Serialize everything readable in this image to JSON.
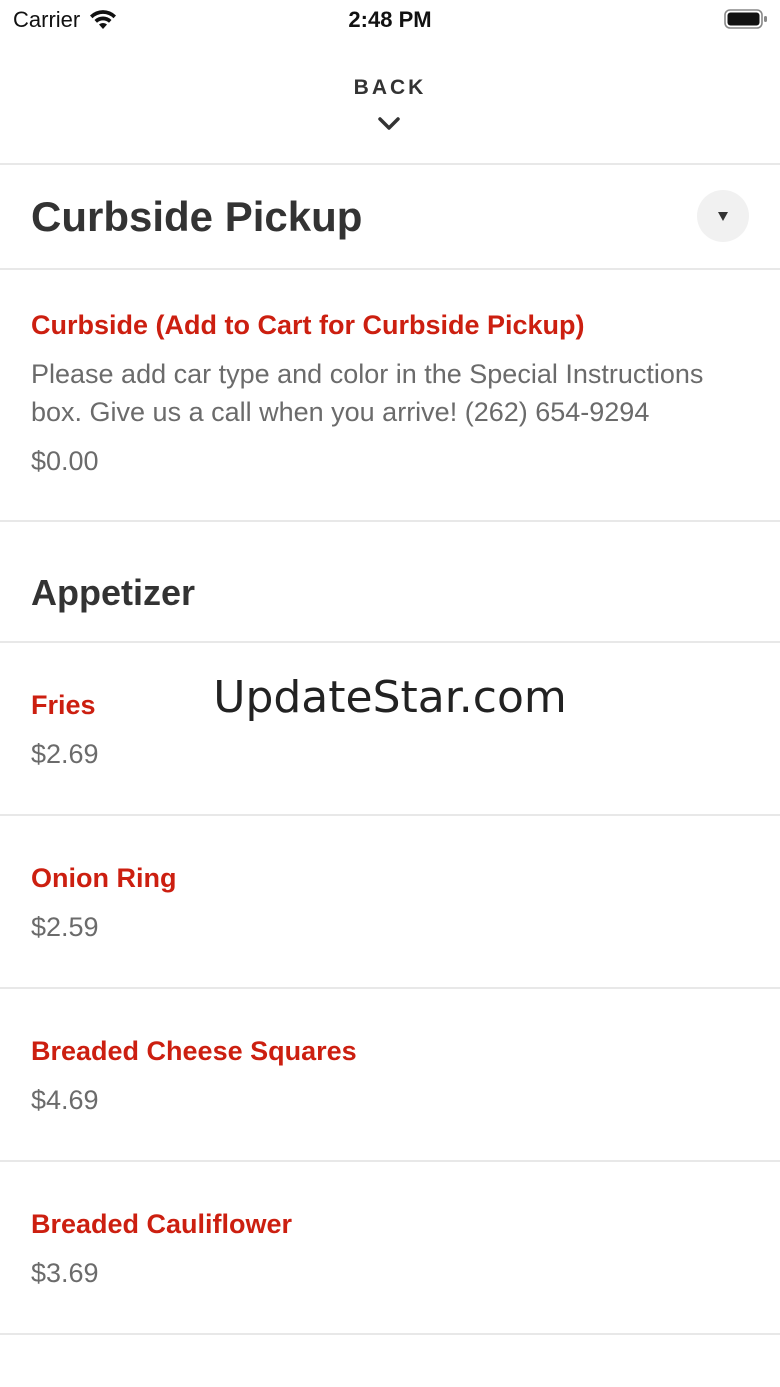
{
  "status_bar": {
    "carrier": "Carrier",
    "time": "2:48 PM"
  },
  "header": {
    "back_label": "BACK"
  },
  "section": {
    "title": "Curbside Pickup"
  },
  "curbside_item": {
    "name": "Curbside (Add to Cart for Curbside Pickup)",
    "description": "Please add car type and color in the Special Instructions box. Give us a call when you arrive! (262) 654-9294",
    "price": "$0.00"
  },
  "category": {
    "title": "Appetizer"
  },
  "items": [
    {
      "name": "Fries",
      "price": "$2.69"
    },
    {
      "name": "Onion Ring",
      "price": "$2.59"
    },
    {
      "name": "Breaded Cheese Squares",
      "price": "$4.69"
    },
    {
      "name": "Breaded Cauliflower",
      "price": "$3.69"
    }
  ],
  "watermark": "UpdateStar.com",
  "colors": {
    "accent_red": "#cc1f10",
    "text_dark": "#333333",
    "text_gray": "#6b6b6b",
    "divider": "#e8e8e8"
  },
  "icons": [
    "wifi-icon",
    "battery-icon",
    "chevron-down-icon",
    "caret-down-icon"
  ]
}
